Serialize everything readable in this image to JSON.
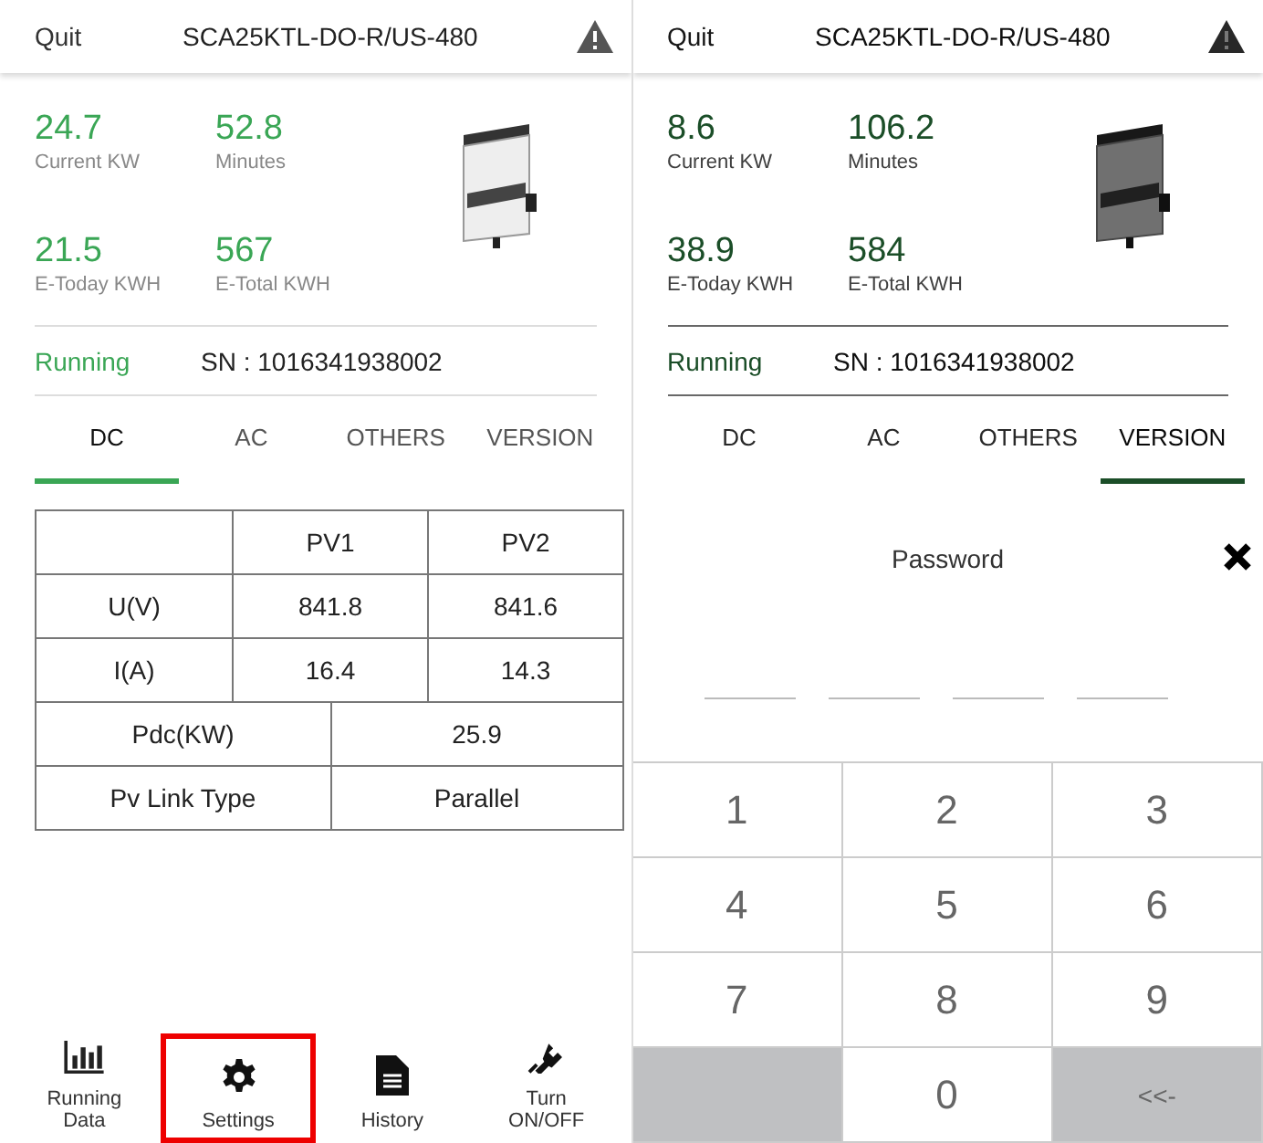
{
  "screens": [
    {
      "dimmed": false,
      "header": {
        "quit": "Quit",
        "title": "SCA25KTL-DO-R/US-480"
      },
      "stats": [
        {
          "value": "24.7",
          "label": "Current KW"
        },
        {
          "value": "52.8",
          "label": "Minutes"
        },
        {
          "value": "21.5",
          "label": "E-Today KWH"
        },
        {
          "value": "567",
          "label": "E-Total KWH"
        }
      ],
      "status": "Running",
      "sn": "SN : 1016341938002",
      "tabs": [
        {
          "label": "DC",
          "selected": true
        },
        {
          "label": "AC",
          "selected": false
        },
        {
          "label": "OTHERS",
          "selected": false
        },
        {
          "label": "VERSION",
          "selected": false
        }
      ],
      "table": {
        "columns": [
          "PV1",
          "PV2"
        ],
        "rows": [
          [
            "U(V)",
            "841.8",
            "841.6"
          ],
          [
            "I(A)",
            "16.4",
            "14.3"
          ],
          [
            "Pdc(KW)",
            "25.9"
          ],
          [
            "Pv Link Type",
            "Parallel"
          ]
        ]
      },
      "nav": [
        {
          "kind": "chart",
          "label": "Running Data",
          "highlighted": false
        },
        {
          "kind": "gear",
          "label": "Settings",
          "highlighted": true
        },
        {
          "kind": "document",
          "label": "History",
          "highlighted": false
        },
        {
          "kind": "plug",
          "label": "Turn ON/OFF",
          "highlighted": false
        }
      ]
    },
    {
      "dimmed": true,
      "header": {
        "quit": "Quit",
        "title": "SCA25KTL-DO-R/US-480"
      },
      "stats": [
        {
          "value": "8.6",
          "label": "Current KW"
        },
        {
          "value": "106.2",
          "label": "Minutes"
        },
        {
          "value": "38.9",
          "label": "E-Today KWH"
        },
        {
          "value": "584",
          "label": "E-Total KWH"
        }
      ],
      "status": "Running",
      "sn": "SN : 1016341938002",
      "tabs": [
        {
          "label": "DC",
          "selected": false
        },
        {
          "label": "AC",
          "selected": false
        },
        {
          "label": "OTHERS",
          "selected": false
        },
        {
          "label": "VERSION",
          "selected": true
        }
      ],
      "password_dialog": {
        "title": "Password",
        "pin_slots": [
          {
            "filled": false
          },
          {
            "filled": false
          },
          {
            "filled": false
          },
          {
            "filled": false
          }
        ],
        "keys": [
          {
            "kind": "digit",
            "label": "1"
          },
          {
            "kind": "digit",
            "label": "2"
          },
          {
            "kind": "digit",
            "label": "3"
          },
          {
            "kind": "digit",
            "label": "4"
          },
          {
            "kind": "digit",
            "label": "5"
          },
          {
            "kind": "digit",
            "label": "6"
          },
          {
            "kind": "digit",
            "label": "7"
          },
          {
            "kind": "digit",
            "label": "8"
          },
          {
            "kind": "digit",
            "label": "9"
          },
          {
            "kind": "blank"
          },
          {
            "kind": "digit",
            "label": "0"
          },
          {
            "kind": "action",
            "label": "<<-"
          }
        ]
      }
    }
  ]
}
